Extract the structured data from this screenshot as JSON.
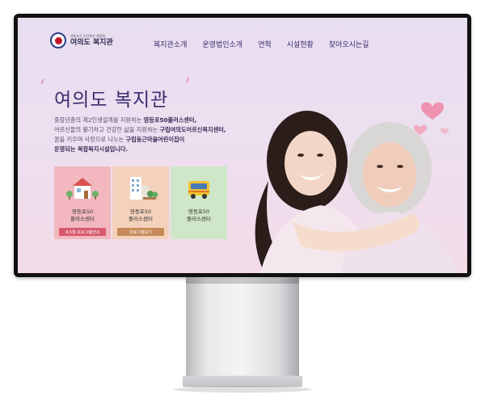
{
  "header": {
    "logo_small": "영등포구 보건복지 연합회",
    "logo_name": "여의도 복지관",
    "nav": [
      "복지관소개",
      "운영법인소개",
      "연혁",
      "시설현황",
      "찾아오시는길"
    ]
  },
  "hero": {
    "title": "여의도 복지관",
    "lines": [
      {
        "plain": "중장년층의 제2인생설계를 지원하는 ",
        "bold": "영등포50플러스센터,"
      },
      {
        "plain": "어르신들의 활기차고 건강한 삶을 지원하는 ",
        "bold": "구립여의도어르신복지센터,"
      },
      {
        "plain": "꿈을 키우며 사랑으로 나누는 ",
        "bold": "구립동근마을어린이집이"
      },
      {
        "plain": "",
        "bold": "운영되는 복합복지시설입니다."
      }
    ]
  },
  "cards": [
    {
      "line1": "영등포50",
      "line2": "플러스센터",
      "button": "4,5월 프로그램안내"
    },
    {
      "line1": "영등포50",
      "line2": "플러스센터",
      "button": "프로그램보기"
    },
    {
      "line1": "영등포50",
      "line2": "플러스센터",
      "button": ""
    }
  ],
  "colors": {
    "nav_text": "#3c2a6a",
    "card_pink": "#f2b7bf",
    "card_peach": "#f3d1bb",
    "card_green": "#cfe6c9",
    "button_red": "#d75a6e",
    "button_brown": "#c88b5a"
  },
  "icons": [
    "emblem-icon",
    "house-icon",
    "building-icon",
    "bus-icon",
    "heart-icon"
  ]
}
